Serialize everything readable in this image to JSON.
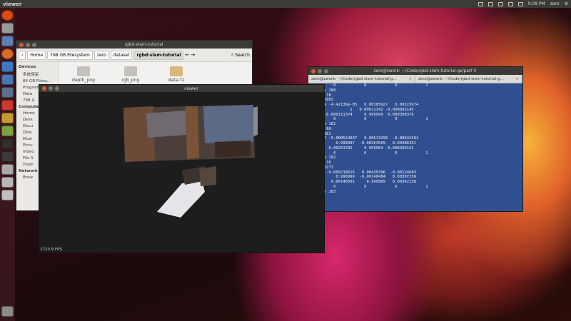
{
  "top_panel": {
    "title": "viewer",
    "time": "9:09 PM",
    "user": "zero"
  },
  "files_window": {
    "title": "rgbd-slam-tutorial",
    "breadcrumbs": [
      "Home",
      "798 GB Filesystem",
      "zero",
      "dataset",
      "rgbd-slam-tutorial"
    ],
    "search_label": "Search",
    "sidebar": {
      "devices_header": "Devices",
      "devices": [
        "系统保留",
        "84 GB Filesy...",
        "Program",
        "Data",
        "798 G"
      ],
      "computer_header": "Compute",
      "computer": [
        "Home",
        "Desk",
        "Docu",
        "Dow",
        "Musi",
        "Pictu",
        "Video",
        "File S",
        "Trash"
      ],
      "network_header": "Network",
      "network": [
        "Brow"
      ]
    },
    "items": [
      {
        "name": "depth_png",
        "icon": "folder-icon"
      },
      {
        "name": "rgb_png",
        "icon": "folder-icon"
      },
      {
        "name": "data.7z",
        "icon": "archive-icon"
      }
    ]
  },
  "viewer_window": {
    "title": "viewer",
    "fps": "1723.9 FPS"
  },
  "terminal": {
    "title": "zero@zwork: ~/Code/rgbd-slam-tutorial-gx/part V",
    "tabs": [
      "zero@zwork: ~/Code/rgbd-slam-tutorial-g...",
      "zero@zwork: ~/Code/rgbd-slam-tutorial-g..."
    ],
    "lines": [
      "          0            0            0            1",
      "g files 180",
      "tches: 38",
      "0.00255903",
      ".999999 -4.42139e-05   0.00105927   0.00115674",
      "9e-05            1   0.00011142 -0.000892145",
      "05927 -0.000111374     0.999999  0.000308376",
      "          0            0            0            1",
      "g files 181",
      "tches: 60",
      "0.0137381",
      ".999987 -0.000524937   0.00513296  -0.00632504",
      "537955     0.999997  -0.00253509   0.00486331",
      "13161   0.00253782     0.999984  0.000399152",
      "          0            0            0            1",
      "g files 182",
      "tches: 16",
      "0.00938273",
      ".99999 -0.000218616   0.00439396  -0.00124683",
      "224787     0.999999  -0.00140484   0.00307256",
      "439365   0.00140501     0.999989   0.00342138",
      "          0            0            0            1",
      "g files 183"
    ]
  }
}
